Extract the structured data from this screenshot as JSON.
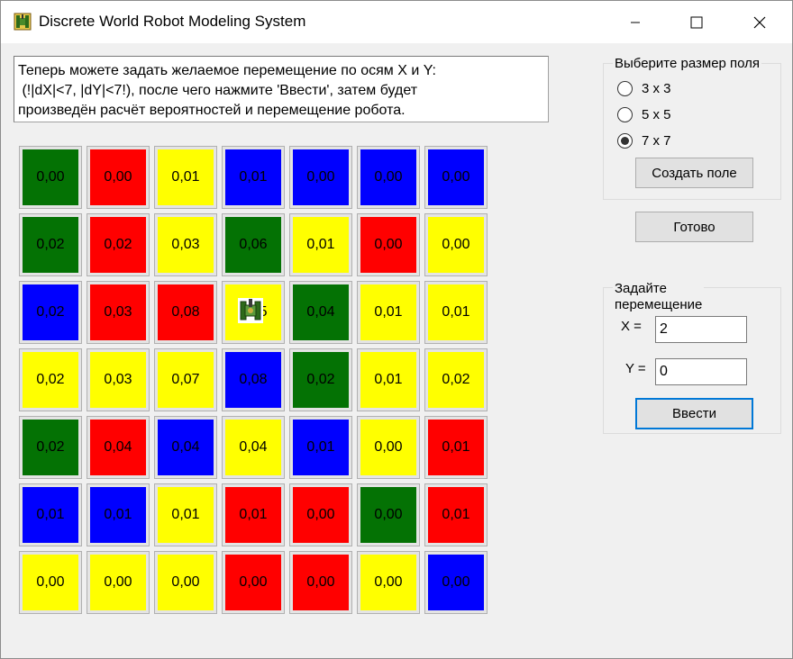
{
  "window": {
    "title": "Discrete World Robot Modeling System"
  },
  "info": {
    "text": "Теперь можете задать желаемое перемещение по осям X и Y:\n (!|dX|<7, |dY|<7!), после чего нажмите 'Ввести', затем будет\nпроизведён расчёт вероятностей и перемещение робота."
  },
  "colors": {
    "G": "#047204",
    "R": "#ff0000",
    "Y": "#ffff00",
    "B": "#0000ff"
  },
  "grid": {
    "robot_position": {
      "row": 2,
      "col": 3
    },
    "rows": [
      [
        {
          "c": "G",
          "v": "0,00"
        },
        {
          "c": "R",
          "v": "0,00"
        },
        {
          "c": "Y",
          "v": "0,01"
        },
        {
          "c": "B",
          "v": "0,01"
        },
        {
          "c": "B",
          "v": "0,00"
        },
        {
          "c": "B",
          "v": "0,00"
        },
        {
          "c": "B",
          "v": "0,00"
        }
      ],
      [
        {
          "c": "G",
          "v": "0,02"
        },
        {
          "c": "R",
          "v": "0,02"
        },
        {
          "c": "Y",
          "v": "0,03"
        },
        {
          "c": "G",
          "v": "0,06"
        },
        {
          "c": "Y",
          "v": "0,01"
        },
        {
          "c": "R",
          "v": "0,00"
        },
        {
          "c": "Y",
          "v": "0,00"
        }
      ],
      [
        {
          "c": "B",
          "v": "0,02"
        },
        {
          "c": "R",
          "v": "0,03"
        },
        {
          "c": "R",
          "v": "0,08"
        },
        {
          "c": "Y",
          "v": "0,15"
        },
        {
          "c": "G",
          "v": "0,04"
        },
        {
          "c": "Y",
          "v": "0,01"
        },
        {
          "c": "Y",
          "v": "0,01"
        }
      ],
      [
        {
          "c": "Y",
          "v": "0,02"
        },
        {
          "c": "Y",
          "v": "0,03"
        },
        {
          "c": "Y",
          "v": "0,07"
        },
        {
          "c": "B",
          "v": "0,08"
        },
        {
          "c": "G",
          "v": "0,02"
        },
        {
          "c": "Y",
          "v": "0,01"
        },
        {
          "c": "Y",
          "v": "0,02"
        }
      ],
      [
        {
          "c": "G",
          "v": "0,02"
        },
        {
          "c": "R",
          "v": "0,04"
        },
        {
          "c": "B",
          "v": "0,04"
        },
        {
          "c": "Y",
          "v": "0,04"
        },
        {
          "c": "B",
          "v": "0,01"
        },
        {
          "c": "Y",
          "v": "0,00"
        },
        {
          "c": "R",
          "v": "0,01"
        }
      ],
      [
        {
          "c": "B",
          "v": "0,01"
        },
        {
          "c": "B",
          "v": "0,01"
        },
        {
          "c": "Y",
          "v": "0,01"
        },
        {
          "c": "R",
          "v": "0,01"
        },
        {
          "c": "R",
          "v": "0,00"
        },
        {
          "c": "G",
          "v": "0,00"
        },
        {
          "c": "R",
          "v": "0,01"
        }
      ],
      [
        {
          "c": "Y",
          "v": "0,00"
        },
        {
          "c": "Y",
          "v": "0,00"
        },
        {
          "c": "Y",
          "v": "0,00"
        },
        {
          "c": "R",
          "v": "0,00"
        },
        {
          "c": "R",
          "v": "0,00"
        },
        {
          "c": "Y",
          "v": "0,00"
        },
        {
          "c": "B",
          "v": "0,00"
        }
      ]
    ]
  },
  "size_group": {
    "title": "Выберите размер поля",
    "options": [
      {
        "label": "3 x 3",
        "checked": false
      },
      {
        "label": "5 x 5",
        "checked": false
      },
      {
        "label": "7 x 7",
        "checked": true
      }
    ],
    "create_button": "Создать поле"
  },
  "ready_button": "Готово",
  "move_group": {
    "title": "Задайте\nперемещение",
    "x_label": "X =",
    "x_value": "2",
    "y_label": "Y =",
    "y_value": "0",
    "submit_button": "Ввести"
  }
}
